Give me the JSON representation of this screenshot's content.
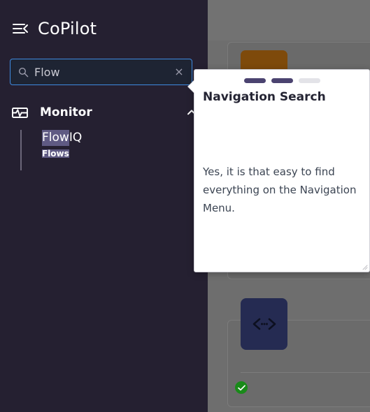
{
  "sidebar": {
    "menu_icon": "menu-collapse-icon",
    "brand_title": "CoPilot",
    "search": {
      "icon": "search-icon",
      "value": "Flow",
      "placeholder": "Search",
      "clear_label": "×",
      "clear_icon": "close-icon"
    },
    "groups": [
      {
        "icon": "monitor-pulse-icon",
        "label": "Monitor",
        "expanded": true,
        "chevron_icon": "chevron-up-icon",
        "items": [
          {
            "title_match": "Flow",
            "title_rest": "IQ",
            "subtitle": "Flows"
          }
        ]
      }
    ]
  },
  "coach_mark": {
    "title": "Navigation Search",
    "body": "Yes, it is that easy to find everything on the Navigation Menu.",
    "steps": [
      {
        "state": "active"
      },
      {
        "state": "active"
      },
      {
        "state": "inactive"
      }
    ],
    "resize_handle_icon": "resize-grip-icon"
  },
  "background": {
    "navy_tile_icon": "code-brackets-icon",
    "status_badge_icon": "check-circle-icon"
  },
  "colors": {
    "sidebar_bg": "#252031",
    "search_border": "#3f8ae0",
    "highlight": "#5f5a83",
    "step_active": "#4b4370",
    "step_inactive": "#e3e3e8",
    "navy_tile": "#252b52",
    "orange_tile": "#7e4a0b",
    "status_green": "#198a19",
    "overlay_dim": "#6e6e6e"
  }
}
